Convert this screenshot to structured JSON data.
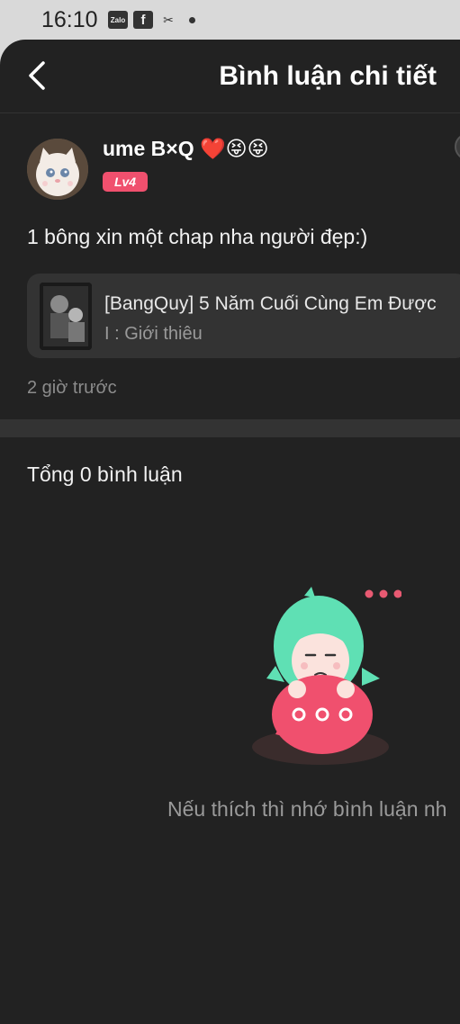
{
  "status_bar": {
    "time": "16:10",
    "icons": [
      "zalo-icon",
      "facebook-icon",
      "capcut-icon",
      "notification-dot"
    ],
    "zalo_text": "Zalo",
    "facebook_text": "f",
    "capcut_text": "✂"
  },
  "header": {
    "title": "Bình luận chi tiết",
    "back_icon": "chevron-left-icon"
  },
  "comment": {
    "username": "ume B×Q",
    "emoji": "❤️😝😝",
    "level": "Lv4",
    "text": "1 bông xin một chap nha người đẹp:)",
    "manga": {
      "title": "[BangQuy] 5 Năm Cuối Cùng Em Được",
      "subtitle": "I : Giới thiêu"
    },
    "time_ago": "2 giờ trước"
  },
  "replies": {
    "total_label": "Tổng 0 bình luận",
    "empty_message": "Nếu thích thì nhớ bình luận nh"
  },
  "colors": {
    "background": "#222222",
    "accent": "#f0506e",
    "card": "#333333",
    "mascot_hair": "#5fe0b4"
  }
}
